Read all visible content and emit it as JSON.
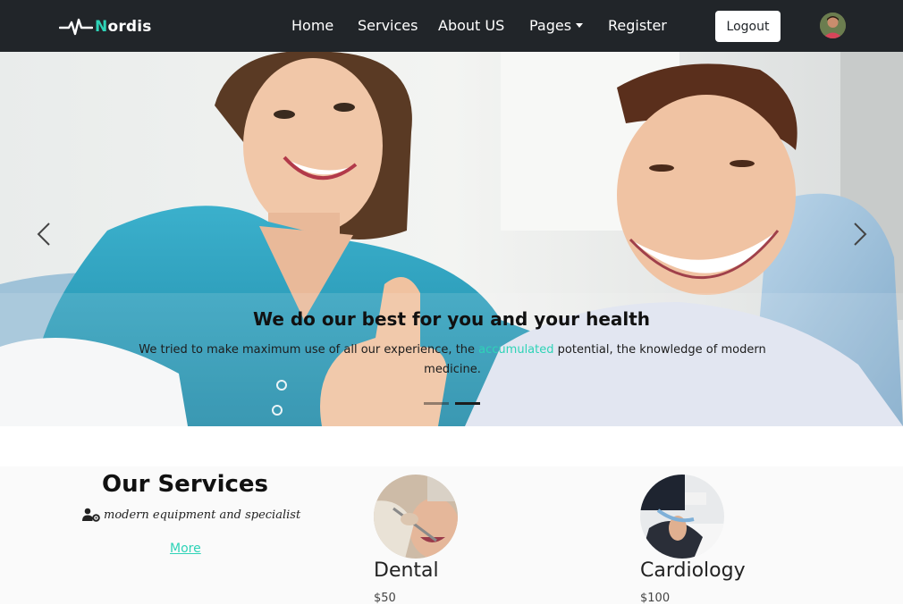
{
  "navbar": {
    "brand_prefix": "N",
    "brand_rest": "ordis",
    "links": [
      {
        "label": "Home"
      },
      {
        "label": "Services"
      },
      {
        "label": "About US"
      },
      {
        "label": "Pages"
      },
      {
        "label": "Register"
      }
    ],
    "logout_label": "Logout",
    "accent_color": "#2ed3b7",
    "bg_color": "#212529"
  },
  "hero": {
    "caption_title": "We do our best for you and your health",
    "caption_text_before": "We tried to make maximum use of all our experience, the ",
    "caption_text_highlight": "accumulated",
    "caption_text_after": " potential, the knowledge of modern medicine.",
    "prev_icon": "chevron-left-icon",
    "next_icon": "chevron-right-icon",
    "active_slide": 2,
    "slide_count": 2
  },
  "services": {
    "title": "Our Services",
    "subtitle": "modern equipment and specialist",
    "subtitle_icon": "user-gear-icon",
    "more_label": "More",
    "items": [
      {
        "name": "Dental",
        "price": "$50"
      },
      {
        "name": "Cardiology",
        "price": "$100"
      }
    ]
  }
}
